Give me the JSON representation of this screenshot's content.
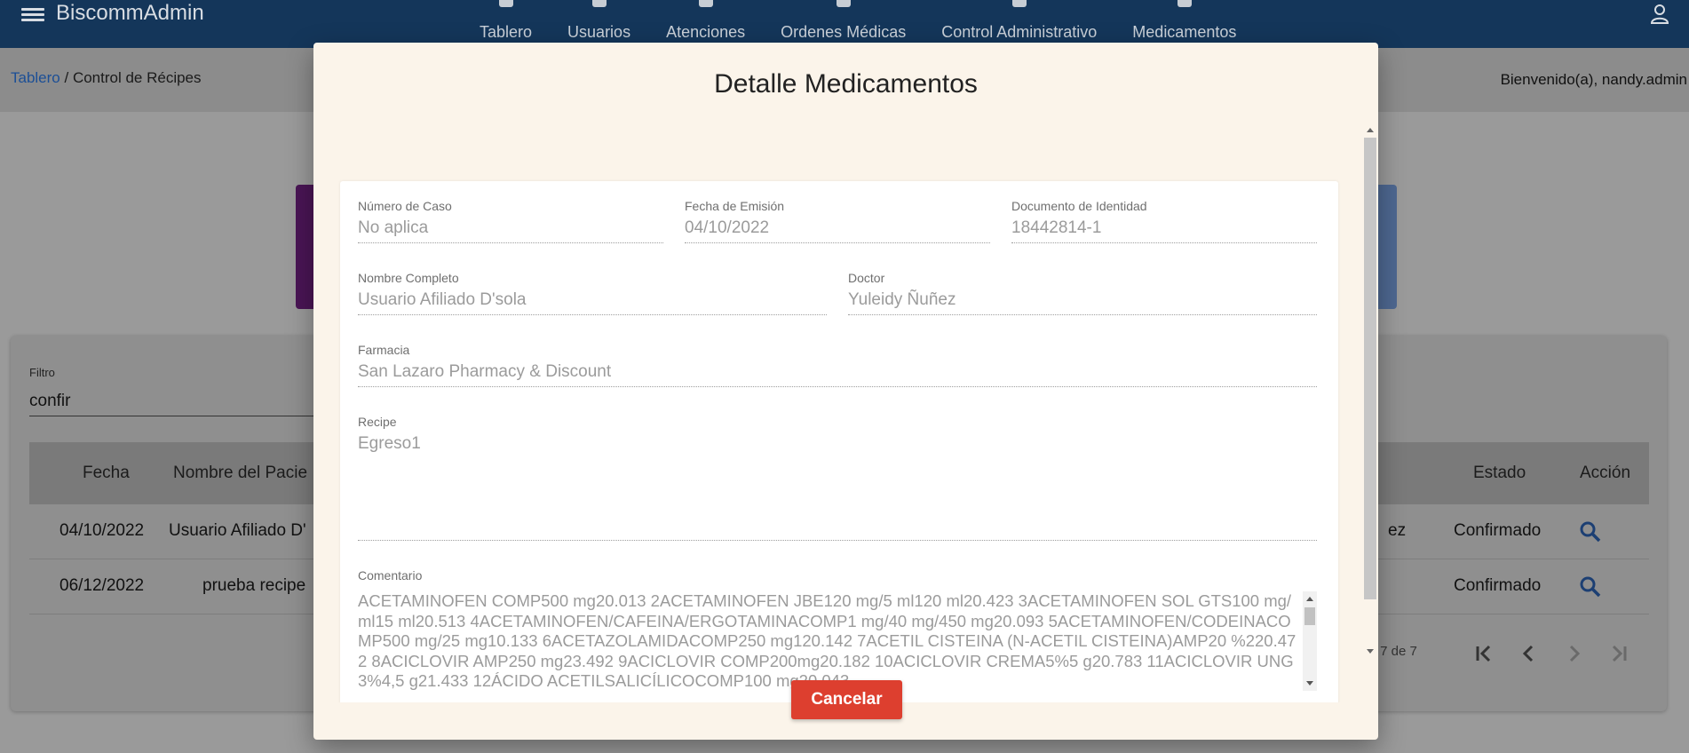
{
  "app": {
    "title": "BiscommAdmin"
  },
  "nav": [
    {
      "label": "Tablero"
    },
    {
      "label": "Usuarios"
    },
    {
      "label": "Atenciones"
    },
    {
      "label": "Ordenes Médicas"
    },
    {
      "label": "Control Administrativo"
    },
    {
      "label": "Medicamentos"
    }
  ],
  "breadcrumb": {
    "home": "Tablero",
    "separator": " / ",
    "current": "Control de Récipes"
  },
  "welcome": "Bienvenido(a), nandy.admin",
  "filter": {
    "label": "Filtro",
    "value": "confir"
  },
  "table": {
    "headers": {
      "fecha": "Fecha",
      "nombre": "Nombre del Pacie",
      "estado": "Estado",
      "accion": "Acción"
    },
    "rows": [
      {
        "fecha": "04/10/2022",
        "nombre": "Usuario Afiliado D'",
        "doctor_tail": "ez",
        "estado": "Confirmado"
      },
      {
        "fecha": "06/12/2022",
        "nombre": "prueba recipe",
        "doctor_tail": "",
        "estado": "Confirmado"
      }
    ]
  },
  "pager": {
    "range": "- 7 de 7"
  },
  "modal": {
    "title": "Detalle Medicamentos",
    "fields": {
      "numero_caso": {
        "label": "Número de Caso",
        "value": "No aplica"
      },
      "fecha_emision": {
        "label": "Fecha de Emisión",
        "value": "04/10/2022"
      },
      "documento": {
        "label": "Documento de Identidad",
        "value": "18442814-1"
      },
      "nombre": {
        "label": "Nombre Completo",
        "value": "Usuario Afiliado D'sola"
      },
      "doctor": {
        "label": "Doctor",
        "value": "Yuleidy Ñuñez"
      },
      "farmacia": {
        "label": "Farmacia",
        "value": "San Lazaro Pharmacy & Discount"
      },
      "recipe": {
        "label": "Recipe",
        "value": "Egreso1"
      },
      "comentario": {
        "label": "Comentario",
        "value": "ACETAMINOFEN COMP500 mg20.013 2ACETAMINOFEN JBE120 mg/5 ml120 ml20.423 3ACETAMINOFEN SOL GTS100 mg/ml15 ml20.513 4ACETAMINOFEN/CAFEINA/ERGOTAMINACOMP1 mg/40 mg/450 mg20.093 5ACETAMINOFEN/CODEINACOMP500 mg/25 mg10.133 6ACETAZOLAMIDACOMP250 mg120.142 7ACETIL CISTEINA (N-ACETIL CISTEINA)AMP20 %220.472 8ACICLOVIR AMP250 mg23.492 9ACICLOVIR COMP200mg20.182 10ACICLOVIR CREMA5%5 g20.783 11ACICLOVIR UNG3%4,5 g21.433 12ÁCIDO ACETILSALICÍLICOCOMP100 mg20.043"
      }
    },
    "cancel_label": "Cancelar"
  }
}
